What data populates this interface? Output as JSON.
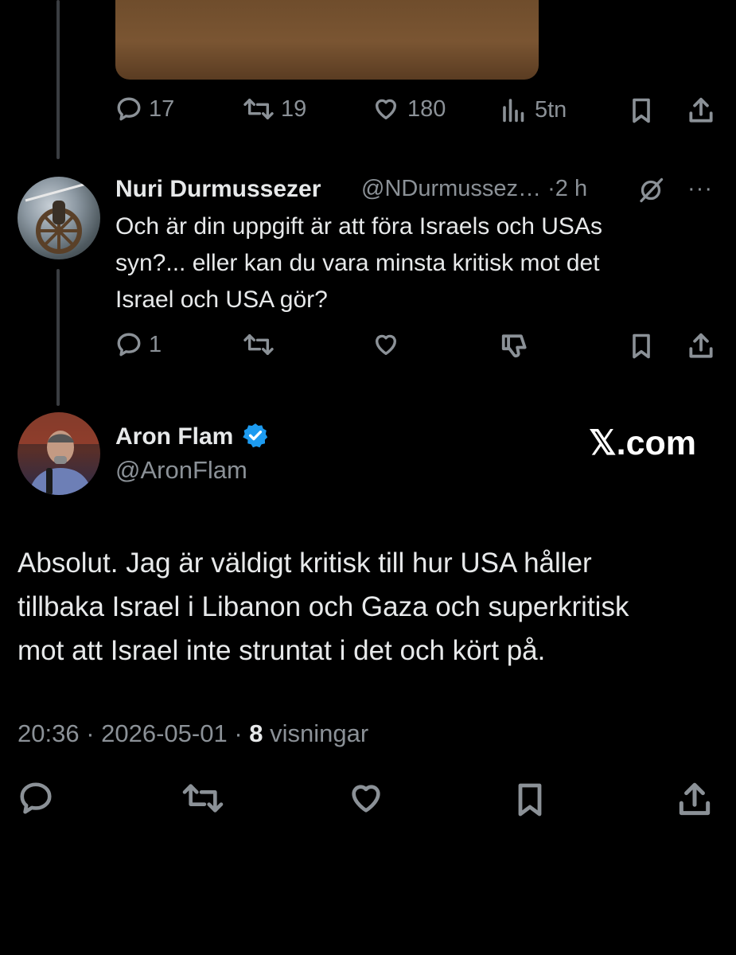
{
  "top_tweet": {
    "stats": {
      "replies": "17",
      "reposts": "19",
      "likes": "180",
      "views": "5tn"
    }
  },
  "reply": {
    "name": "Nuri Durmussezer",
    "handle": "@NDurmussez…",
    "time": "2 h",
    "more": "···",
    "text_lines": [
      "Och är din uppgift är att föra Israels och USAs",
      "syn?... eller kan du vara minsta kritisk mot det",
      "Israel och USA gör?"
    ],
    "stats": {
      "replies": "1"
    }
  },
  "main_tweet": {
    "name": "Aron Flam",
    "handle": "@AronFlam",
    "watermark": "𝕏.com",
    "text_lines": [
      "Absolut. Jag är väldigt kritisk till hur USA håller",
      "tillbaka Israel i Libanon och Gaza och superkritisk",
      "mot att Israel inte struntat i det och kört på."
    ],
    "time": "20:36",
    "date": "2026-05-01",
    "views_count": "8",
    "views_label": "visningar"
  },
  "colors": {
    "background": "#000000",
    "text": "#e7e9ea",
    "muted": "#8b9197",
    "verified": "#1d9bf0"
  }
}
